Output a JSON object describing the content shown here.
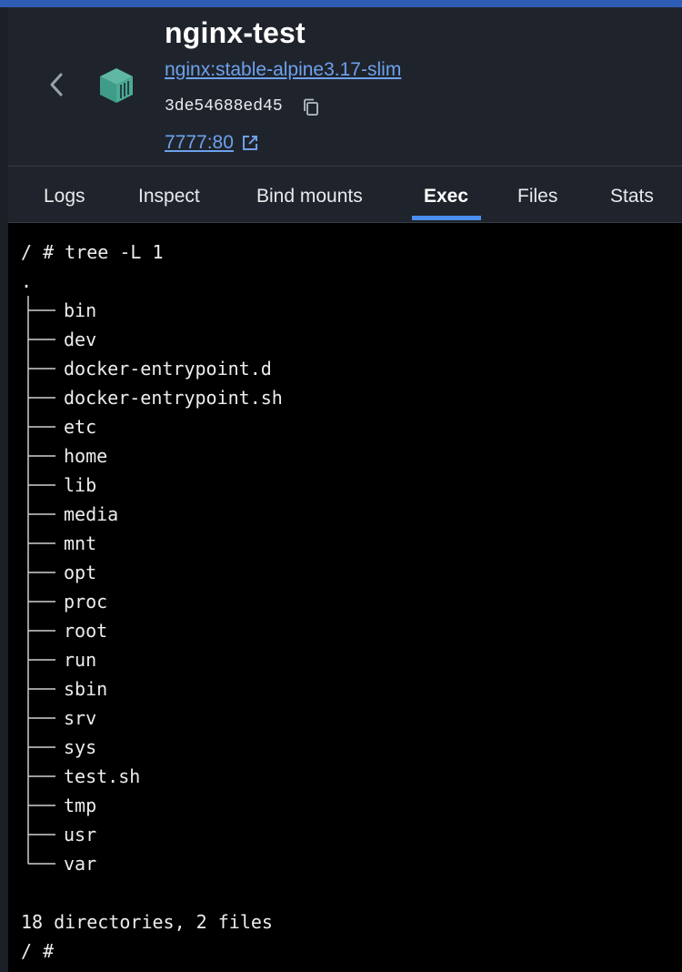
{
  "header": {
    "title": "nginx-test",
    "image": "nginx:stable-alpine3.17-slim",
    "container_id": "3de54688ed45",
    "port": "7777:80"
  },
  "tabs": [
    {
      "label": "Logs",
      "active": false
    },
    {
      "label": "Inspect",
      "active": false
    },
    {
      "label": "Bind mounts",
      "active": false
    },
    {
      "label": "Exec",
      "active": true
    },
    {
      "label": "Files",
      "active": false
    },
    {
      "label": "Stats",
      "active": false
    }
  ],
  "terminal": {
    "command_line": "/ # tree -L 1",
    "root": ".",
    "entries": [
      "bin",
      "dev",
      "docker-entrypoint.d",
      "docker-entrypoint.sh",
      "etc",
      "home",
      "lib",
      "media",
      "mnt",
      "opt",
      "proc",
      "root",
      "run",
      "sbin",
      "srv",
      "sys",
      "test.sh",
      "tmp",
      "usr",
      "var"
    ],
    "summary": "18 directories, 2 files",
    "prompt": "/ #"
  },
  "colors": {
    "accent": "#4a8ff0",
    "link": "#6ea1ec",
    "header_bg": "#1f242c",
    "topbar": "#2f5db5"
  },
  "icons": [
    "chevron-left-icon",
    "container-icon",
    "copy-icon",
    "external-link-icon"
  ]
}
